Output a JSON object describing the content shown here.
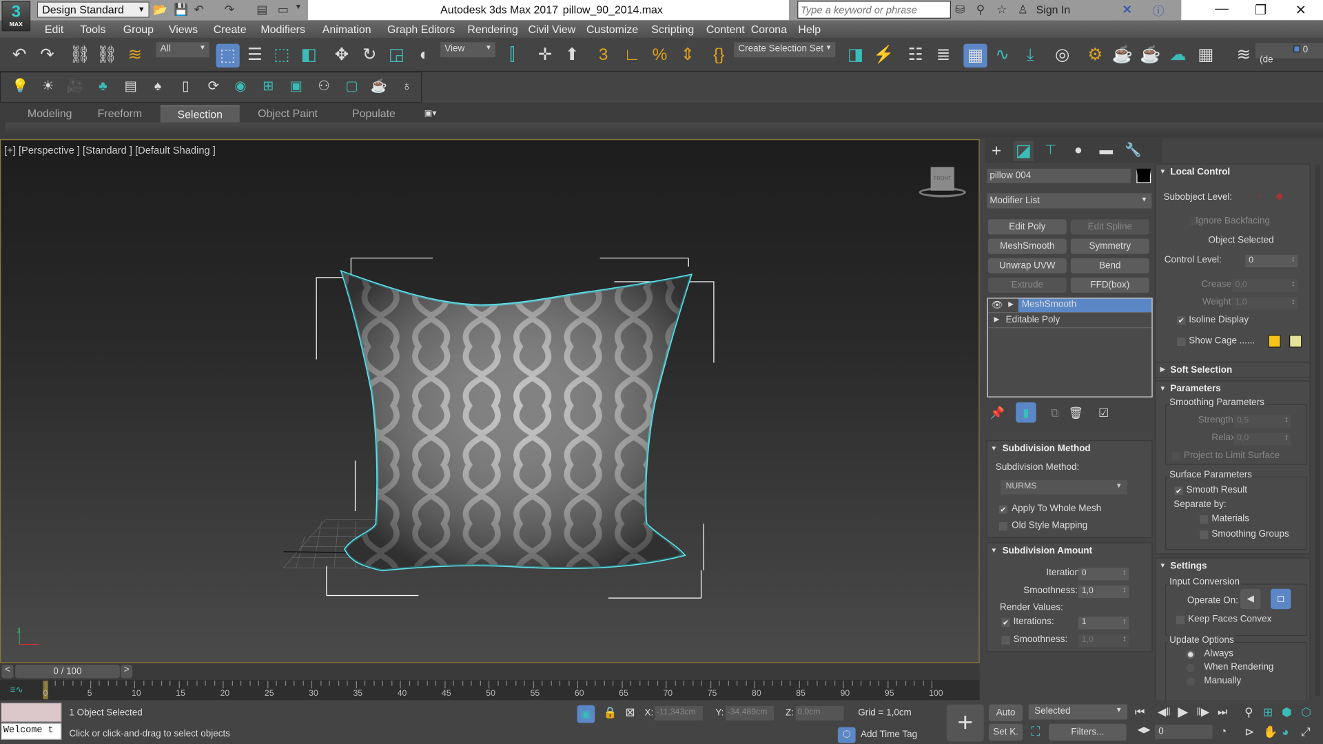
{
  "titlebar": {
    "workspace": "Design Standard",
    "app_title": "Autodesk 3ds Max 2017",
    "file_name": "pillow_90_2014.max",
    "search_placeholder": "Type a keyword or phrase",
    "sign_in": "Sign In",
    "logo_text": "3",
    "logo_sub": "MAX"
  },
  "menu": [
    "Edit",
    "Tools",
    "Group",
    "Views",
    "Create",
    "Modifiers",
    "Animation",
    "Graph Editors",
    "Rendering",
    "Civil View",
    "Customize",
    "Scripting",
    "Content",
    "Corona",
    "Help"
  ],
  "toolbar": {
    "filter": "All",
    "ref_coord": "View",
    "selection_set": "Create Selection Set",
    "layer": "0 (de"
  },
  "ribbon": {
    "tabs": [
      "Modeling",
      "Freeform",
      "Selection",
      "Object Paint",
      "Populate"
    ],
    "active": "Selection"
  },
  "viewport": {
    "label": "[+] [Perspective ] [Standard ] [Default Shading ]",
    "viewcube": "FRONT"
  },
  "command_panel": {
    "object_name": "pillow 004",
    "modifier_list": "Modifier List",
    "modifier_buttons": [
      {
        "label": "Edit Poly",
        "enabled": true
      },
      {
        "label": "Edit Spline",
        "enabled": false
      },
      {
        "label": "MeshSmooth",
        "enabled": true
      },
      {
        "label": "Symmetry",
        "enabled": true
      },
      {
        "label": "Unwrap UVW",
        "enabled": true
      },
      {
        "label": "Bend",
        "enabled": true
      },
      {
        "label": "Extrude",
        "enabled": false
      },
      {
        "label": "FFD(box)",
        "enabled": true
      }
    ],
    "stack": [
      "MeshSmooth",
      "Editable Poly"
    ],
    "subdivision_method": {
      "title": "Subdivision Method",
      "label": "Subdivision Method:",
      "value": "NURMS",
      "apply_whole_mesh": "Apply To Whole Mesh",
      "old_style": "Old Style Mapping"
    },
    "subdivision_amount": {
      "title": "Subdivision Amount",
      "iterations_label": "Iterations:",
      "iterations": "0",
      "smoothness_label": "Smoothness:",
      "smoothness": "1,0",
      "render_values": "Render Values:",
      "r_iterations_label": "Iterations:",
      "r_iterations": "1",
      "r_smoothness_label": "Smoothness:",
      "r_smoothness": "1,0"
    },
    "local_control": {
      "title": "Local Control",
      "subobject": "Subobject Level:",
      "ignore_backfacing": "Ignore Backfacing",
      "object_selected": "Object Selected",
      "control_level_label": "Control Level:",
      "control_level": "0",
      "crease_label": "Crease:",
      "crease": "0,0",
      "weight_label": "Weight:",
      "weight": "1,0",
      "isoline": "Isoline Display",
      "show_cage": "Show Cage ......",
      "cage_color1": "#f5c518",
      "cage_color2": "#e6e39a"
    },
    "soft_selection": "Soft Selection",
    "parameters": {
      "title": "Parameters",
      "smoothing": "Smoothing Parameters",
      "strength_label": "Strength:",
      "strength": "0,5",
      "relax_label": "Relax:",
      "relax": "0,0",
      "project": "Project to Limit Surface",
      "surface": "Surface Parameters",
      "smooth_result": "Smooth Result",
      "separate_by": "Separate by:",
      "materials": "Materials",
      "smoothing_groups": "Smoothing Groups"
    },
    "settings": {
      "title": "Settings",
      "input_conversion": "Input Conversion",
      "operate_on": "Operate On:",
      "keep_convex": "Keep Faces Convex",
      "update_options": "Update Options",
      "always": "Always",
      "when_rendering": "When Rendering",
      "manually": "Manually"
    }
  },
  "timeline": {
    "frame": "0 / 100",
    "ticks": [
      "0",
      "5",
      "10",
      "15",
      "20",
      "25",
      "30",
      "35",
      "40",
      "45",
      "50",
      "55",
      "60",
      "65",
      "70",
      "75",
      "80",
      "85",
      "90",
      "95",
      "100"
    ]
  },
  "status": {
    "selected": "1 Object Selected",
    "prompt": "Click or click-and-drag to select objects",
    "maxscript": "Welcome t",
    "x_label": "X:",
    "x": "-11,343cm",
    "y_label": "Y:",
    "y": "-34,489cm",
    "z_label": "Z:",
    "z": "0,0cm",
    "grid": "Grid = 1,0cm",
    "add_time_tag": "Add Time Tag",
    "auto": "Auto",
    "set_key": "Set K.",
    "key_filter": "Selected",
    "filters": "Filters...",
    "current_frame": "0"
  },
  "colors": {
    "accent": "#5b87c6",
    "teal": "#3bbcb8",
    "selection_outline": "#5fe0e8",
    "viewport_border": "#8a7a3a"
  }
}
